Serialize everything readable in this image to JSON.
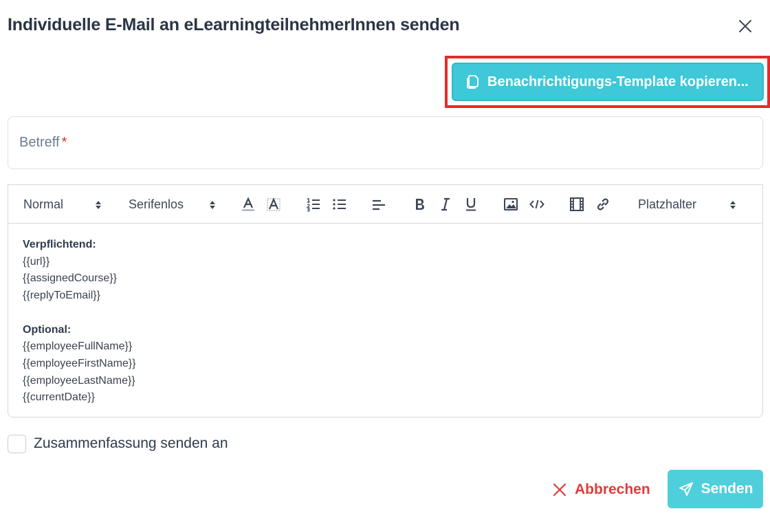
{
  "dialog": {
    "title": "Individuelle E-Mail an eLearningteilnehmerInnen senden"
  },
  "template_button": {
    "label": "Benachrichtigungs-Template kopieren..."
  },
  "subject": {
    "label": "Betreff",
    "required_mark": "*"
  },
  "toolbar": {
    "format_select": "Normal",
    "font_select": "Serifenlos",
    "placeholder_select": "Platzhalter"
  },
  "editor": {
    "required_heading": "Verpflichtend:",
    "required_items": [
      "{{url}}",
      "{{assignedCourse}}",
      "{{replyToEmail}}"
    ],
    "optional_heading": "Optional:",
    "optional_items": [
      "{{employeeFullName}}",
      "{{employeeFirstName}}",
      "{{employeeLastName}}",
      "{{currentDate}}"
    ]
  },
  "summary": {
    "label": "Zusammenfassung senden an",
    "checked": false
  },
  "footer": {
    "cancel_label": "Abbrechen",
    "send_label": "Senden"
  },
  "colors": {
    "accent": "#3ec8d8",
    "danger": "#e13b3b",
    "highlight": "#e32b2b"
  }
}
